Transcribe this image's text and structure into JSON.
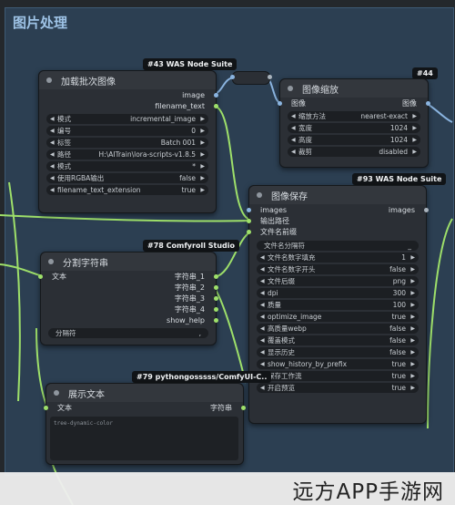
{
  "group": {
    "title": "图片处理"
  },
  "node_batch": {
    "badge": "#43 WAS Node Suite",
    "title": "加载批次图像",
    "outputs": [
      "image",
      "filename_text"
    ],
    "widgets": [
      {
        "label": "模式",
        "value": "incremental_image"
      },
      {
        "label": "编号",
        "value": "0"
      },
      {
        "label": "标签",
        "value": "Batch 001"
      },
      {
        "label": "路径",
        "value": "H:\\AITrain\\lora-scripts-v1.8.5"
      },
      {
        "label": "模式",
        "value": "*"
      },
      {
        "label": "使用RGBA输出",
        "value": "false"
      },
      {
        "label": "filename_text_extension",
        "value": "true"
      }
    ]
  },
  "node_scale": {
    "badge": "#44",
    "title": "图像缩放",
    "input": "图像",
    "output": "图像",
    "widgets": [
      {
        "label": "缩放方法",
        "value": "nearest-exact"
      },
      {
        "label": "宽度",
        "value": "1024"
      },
      {
        "label": "高度",
        "value": "1024"
      },
      {
        "label": "裁剪",
        "value": "disabled"
      }
    ]
  },
  "node_save": {
    "badge": "#93 WAS Node Suite",
    "title": "图像保存",
    "input_images": "images",
    "output_images": "images",
    "inputs": [
      "输出路径",
      "文件名前缀"
    ],
    "separator": {
      "label": "文件名分隔符",
      "value": "_"
    },
    "widgets": [
      {
        "label": "文件名数字填充",
        "value": "1"
      },
      {
        "label": "文件名数字开头",
        "value": "false"
      },
      {
        "label": "文件后缀",
        "value": "png"
      },
      {
        "label": "dpi",
        "value": "300"
      },
      {
        "label": "质量",
        "value": "100"
      },
      {
        "label": "optimize_image",
        "value": "true"
      },
      {
        "label": "高质量webp",
        "value": "false"
      },
      {
        "label": "覆盖模式",
        "value": "false"
      },
      {
        "label": "显示历史",
        "value": "false"
      },
      {
        "label": "show_history_by_prefix",
        "value": "true"
      },
      {
        "label": "保存工作流",
        "value": "true"
      },
      {
        "label": "开启预览",
        "value": "true"
      }
    ]
  },
  "node_split": {
    "badge": "#78 Comfyroll Studio",
    "title": "分割字符串",
    "input": "文本",
    "outputs": [
      "字符串_1",
      "字符串_2",
      "字符串_3",
      "字符串_4",
      "show_help"
    ],
    "widget": {
      "label": "分隔符",
      "value": ","
    }
  },
  "node_show": {
    "badge": "#79 pythongosssss/ComfyUI-C..",
    "title": "展示文本",
    "input": "文本",
    "output": "字符串",
    "text": "tree-dynamic-color"
  },
  "watermark": "远方APP手游网"
}
